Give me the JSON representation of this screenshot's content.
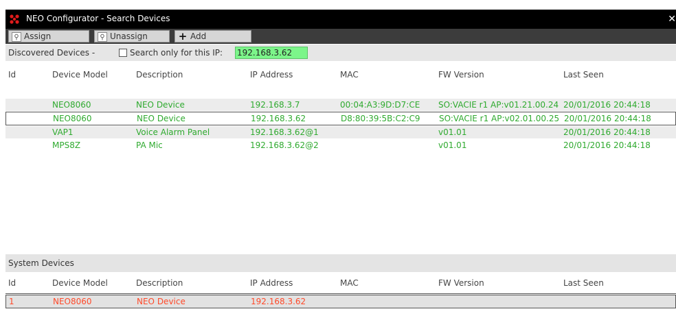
{
  "window": {
    "title": "NEO Configurator - Search Devices",
    "close_glyph": "✕"
  },
  "toolbar": {
    "assign": "Assign",
    "unassign": "Unassign",
    "add": "Add"
  },
  "search": {
    "label": "Discovered Devices -",
    "checkbox_label": "Search only for this IP:",
    "checked": false,
    "ip_value": "192.168.3.62"
  },
  "columns": [
    "Id",
    "Device Model",
    "Description",
    "IP Address",
    "MAC",
    "FW Version",
    "Last Seen"
  ],
  "discovered": [
    {
      "id": "",
      "model": "NEO8060",
      "desc": "NEO Device",
      "ip": "192.168.3.7",
      "mac": "00:04:A3:9D:D7:CE",
      "fw": "SO:VACIE r1 AP:v01.21.00.24",
      "seen": "20/01/2016 20:44:18"
    },
    {
      "id": "",
      "model": "NEO8060",
      "desc": "NEO Device",
      "ip": "192.168.3.62",
      "mac": "D8:80:39:5B:C2:C9",
      "fw": "SO:VACIE r1 AP:v02.01.00.25",
      "seen": "20/01/2016 20:44:18"
    },
    {
      "id": "",
      "model": "VAP1",
      "desc": "Voice Alarm Panel",
      "ip": "192.168.3.62@1",
      "mac": "",
      "fw": "v01.01",
      "seen": "20/01/2016 20:44:18"
    },
    {
      "id": "",
      "model": "MPS8Z",
      "desc": "PA Mic",
      "ip": "192.168.3.62@2",
      "mac": "",
      "fw": "v01.01",
      "seen": "20/01/2016 20:44:18"
    }
  ],
  "system": {
    "title": "System Devices",
    "rows": [
      {
        "id": "1",
        "model": "NEO8060",
        "desc": "NEO Device",
        "ip": "192.168.3.62",
        "mac": "",
        "fw": "",
        "seen": ""
      }
    ]
  },
  "colors": {
    "discovered_text": "#2faa2f",
    "system_text": "#ff4a2a",
    "ip_field": "#7cf58a",
    "titlebar": "#000000",
    "toolbar": "#3c3c3c"
  }
}
